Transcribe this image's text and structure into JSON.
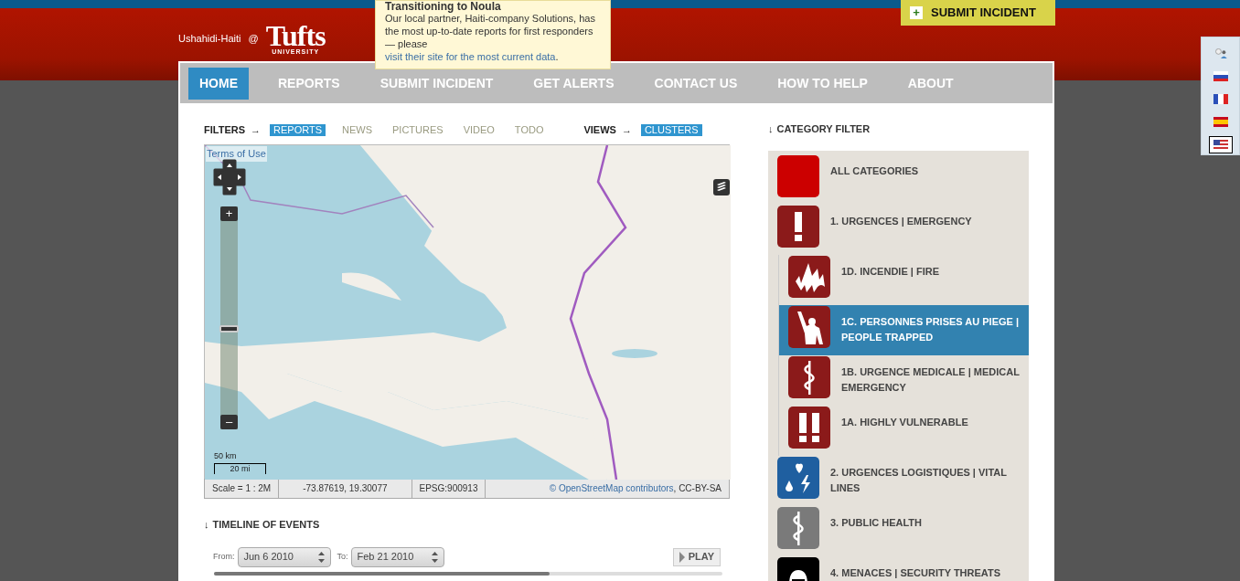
{
  "header": {
    "site_name": "Ushahidi-Haiti",
    "at_sign": "@",
    "logo_word": "Tufts",
    "logo_sub": "UNIVERSITY"
  },
  "notice": {
    "title": "Transitioning to Noula",
    "text_before": "Our local partner, Haiti-company Solutions, has the most up-to-date reports for first responders — please ",
    "link": "visit their site for the most current data",
    "text_after": "."
  },
  "submit_button": {
    "icon": "+",
    "label": "SUBMIT INCIDENT"
  },
  "language_menu": [
    {
      "kind": "chat",
      "selected": false
    },
    {
      "kind": "ru",
      "selected": false
    },
    {
      "kind": "fr",
      "selected": false
    },
    {
      "kind": "es",
      "selected": false
    },
    {
      "kind": "us",
      "selected": true
    }
  ],
  "nav_tabs": [
    {
      "label": "HOME",
      "selected": true
    },
    {
      "label": "REPORTS",
      "selected": false
    },
    {
      "label": "SUBMIT INCIDENT",
      "selected": false
    },
    {
      "label": "GET ALERTS",
      "selected": false
    },
    {
      "label": "CONTACT US",
      "selected": false
    },
    {
      "label": "HOW TO HELP",
      "selected": false
    },
    {
      "label": "ABOUT",
      "selected": false
    }
  ],
  "filters": {
    "label": "FILTERS",
    "arrow": "→",
    "items": [
      {
        "label": "REPORTS",
        "selected": true
      },
      {
        "label": "NEWS",
        "selected": false
      },
      {
        "label": "PICTURES",
        "selected": false
      },
      {
        "label": "VIDEO",
        "selected": false
      },
      {
        "label": "TODO",
        "selected": false
      }
    ]
  },
  "views": {
    "label": "VIEWS",
    "arrow": "→",
    "items": [
      {
        "label": "CLUSTERS",
        "selected": true
      }
    ]
  },
  "map": {
    "terms_link": "Terms of Use",
    "zoom_in": "+",
    "zoom_out": "–",
    "scale_km": "50 km",
    "scale_mi": "20 mi",
    "status_bar": {
      "scale": "Scale = 1 : 2M",
      "coordinates": "-73.87619, 19.30077",
      "projection": "EPSG:900913",
      "attribution_link": "© OpenStreetMap contributors",
      "attribution_rest": ", CC-BY-SA"
    }
  },
  "timeline": {
    "arrow": "↓",
    "title": "TIMELINE OF EVENTS",
    "from_label": "From:",
    "from_value": "Jun 6 2010",
    "to_label": "To:",
    "to_value": "Feb 21 2010",
    "play_button": "PLAY",
    "level": 0.66
  },
  "category_filter": {
    "arrow": "↓",
    "title": "CATEGORY FILTER",
    "items": [
      {
        "label": "ALL CATEGORIES",
        "kind": "blank",
        "color": "#cc0000",
        "selected": false
      },
      {
        "label": "1. URGENCES | EMERGENCY",
        "kind": "exclamation",
        "color": "#8b1a1a",
        "selected": false,
        "children": [
          {
            "label": "1D. INCENDIE | FIRE",
            "kind": "fire",
            "color": "#8b1a1a",
            "selected": false
          },
          {
            "label": "1C. PERSONNES PRISES AU PIEGE | PEOPLE TRAPPED",
            "kind": "person",
            "color": "#8b1a1a",
            "selected": true
          },
          {
            "label": "1B. URGENCE MEDICALE | MEDICAL EMERGENCY",
            "kind": "medical",
            "color": "#8b1a1a",
            "selected": false
          },
          {
            "label": "1A. HIGHLY VULNERABLE",
            "kind": "double-exclamation",
            "color": "#8b1a1a",
            "selected": false
          }
        ]
      },
      {
        "label": "2. URGENCES LOGISTIQUES | VITAL LINES",
        "kind": "utilities",
        "color": "#1f5fa0",
        "selected": false
      },
      {
        "label": "3. PUBLIC HEALTH",
        "kind": "medical",
        "color": "#7a7a7a",
        "selected": false
      },
      {
        "label": "4. MENACES | SECURITY THREATS",
        "kind": "masked",
        "color": "#000000",
        "selected": false
      }
    ]
  }
}
